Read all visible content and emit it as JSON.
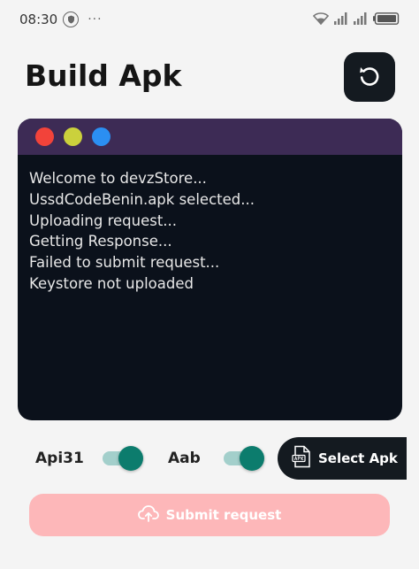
{
  "status_bar": {
    "time": "08:30",
    "more": "···",
    "icons": [
      "shield-icon",
      "wifi-icon",
      "signal-icon",
      "signal-icon",
      "battery-icon"
    ]
  },
  "header": {
    "title": "Build Apk",
    "refresh_icon": "refresh-icon"
  },
  "terminal": {
    "window_dots": [
      "#f2433a",
      "#cbd13c",
      "#2b8ff2"
    ],
    "background": "#0b111b",
    "bar_color": "#3d2b55",
    "lines": [
      "Welcome to devzStore...",
      "UssdCodeBenin.apk selected...",
      "Uploading request...",
      "Getting Response...",
      "Failed to submit request...",
      "Keystore not uploaded"
    ]
  },
  "controls": {
    "api31": {
      "label": "Api31",
      "on": true
    },
    "aab": {
      "label": "Aab",
      "on": true
    },
    "toggle_colors": {
      "track": "#a3cfcb",
      "knob": "#0c7c6d"
    },
    "select_apk": {
      "label": "Select Apk",
      "icon": "apk-file-icon"
    }
  },
  "submit": {
    "label": "Submit request",
    "icon": "cloud-upload-icon",
    "color": "#fdb7b9"
  }
}
